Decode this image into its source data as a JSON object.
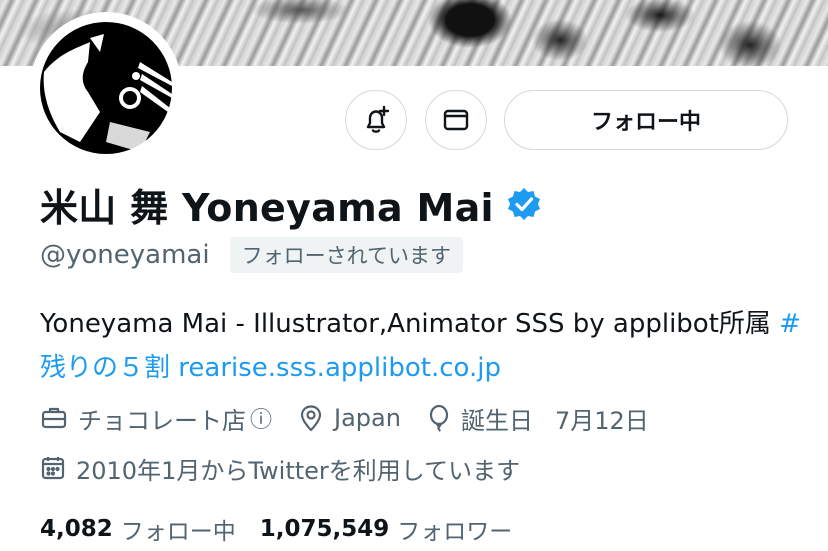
{
  "profile": {
    "display_name": "米山 舞 Yoneyama Mai",
    "handle": "@yoneyamai",
    "follows_you": "フォローされています",
    "follow_button": "フォロー中",
    "bio_text": "Yoneyama Mai - Illustrator,Animator SSS by applibot所属 ",
    "bio_hashtag": "#残りの５割",
    "bio_link": "rearise.sss.applibot.co.jp",
    "professional_category": "チョコレート店",
    "location": "Japan",
    "birthday_label": "誕生日",
    "birthday": "7月12日",
    "joined": "2010年1月からTwitterを利用しています",
    "following_count": "4,082",
    "following_label": "フォロー中",
    "followers_count": "1,075,549",
    "followers_label": "フォロワー"
  },
  "icons": {
    "notify": "bell-plus-icon",
    "message": "envelope-icon",
    "verified": "verified-badge-icon",
    "category": "briefcase-icon",
    "info": "info-icon",
    "location": "location-pin-icon",
    "birthday": "balloon-icon",
    "joined": "calendar-icon"
  },
  "colors": {
    "accent": "#1d9bf0",
    "secondary_text": "#536471",
    "primary_text": "#0f1419"
  }
}
